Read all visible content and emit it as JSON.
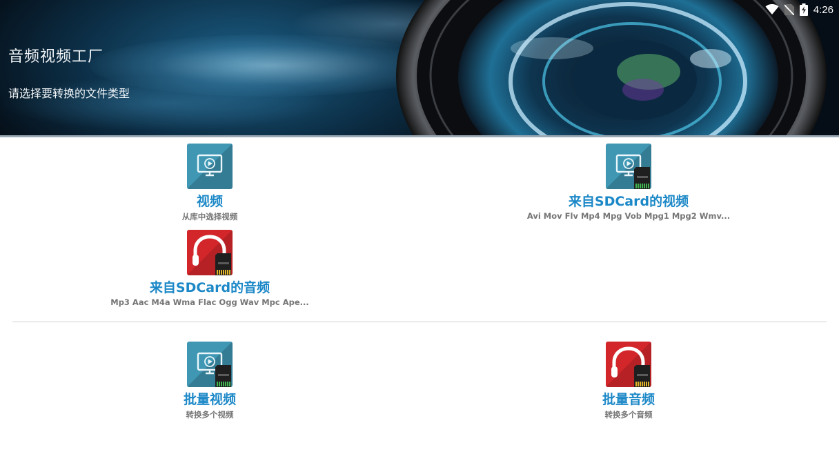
{
  "header": {
    "title": "音频视频工厂",
    "subtitle": "请选择要转换的文件类型"
  },
  "status_bar": {
    "time": "4:26",
    "icons": [
      "wifi-icon",
      "no-sim-icon",
      "battery-charging-icon"
    ]
  },
  "options": [
    {
      "label": "视频",
      "sub": "从库中选择视频",
      "icon": "video-icon",
      "color": "#3f97b4"
    },
    {
      "label": "来自SDCard的视频",
      "sub": "Avi Mov Flv Mp4 Mpg Vob Mpg1 Mpg2 Wmv...",
      "icon": "video-sdcard-icon",
      "color": "#3f97b4"
    },
    {
      "label": "来自SDCard的音频",
      "sub": "Mp3 Aac M4a Wma Flac Ogg Wav Mpc Ape...",
      "icon": "audio-sdcard-icon",
      "color": "#d3262b"
    },
    {
      "label": "批量视频",
      "sub": "转换多个视频",
      "icon": "video-sdcard-icon",
      "color": "#3f97b4"
    },
    {
      "label": "批量音频",
      "sub": "转换多个音频",
      "icon": "audio-sdcard-icon",
      "color": "#d3262b"
    }
  ],
  "colors": {
    "accent": "#1c88c7",
    "subtext": "#757575"
  }
}
